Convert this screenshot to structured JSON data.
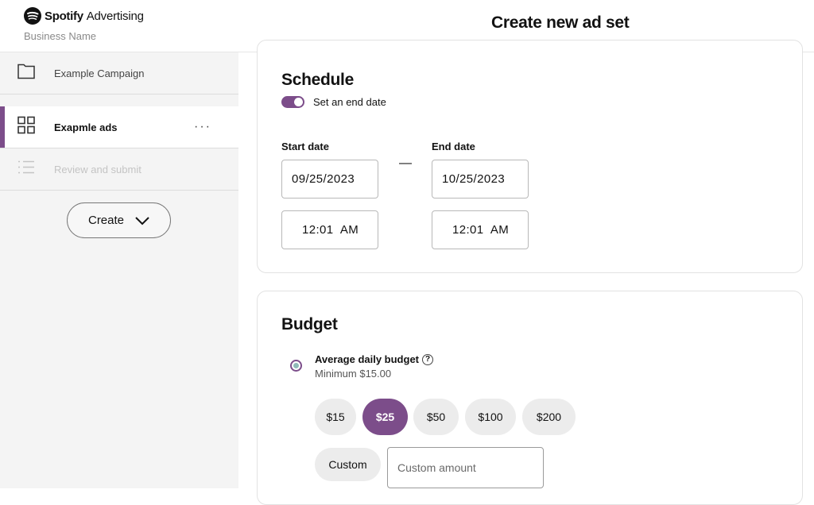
{
  "header": {
    "brand": "Spotify",
    "brand_suffix": "Advertising",
    "business_name": "Business Name",
    "page_title": "Create new ad set"
  },
  "sidebar": {
    "items": [
      {
        "label": "Example Campaign",
        "icon": "folder-icon",
        "state": "normal"
      },
      {
        "label": "Exapmle ads",
        "icon": "grid-icon",
        "state": "active"
      },
      {
        "label": "Review and submit",
        "icon": "list-icon",
        "state": "disabled"
      }
    ],
    "more_label": "···",
    "create_label": "Create"
  },
  "schedule": {
    "title": "Schedule",
    "toggle_label": "Set an end date",
    "toggle_on": true,
    "start_label": "Start date",
    "end_label": "End date",
    "start_date": "09/25/2023",
    "end_date": "10/25/2023",
    "start_time": "12:01  AM",
    "end_time": "12:01  AM",
    "separator": "—"
  },
  "budget": {
    "title": "Budget",
    "option_label": "Average daily budget",
    "option_help": "?",
    "option_sub": "Minimum $15.00",
    "chips": [
      "$15",
      "$25",
      "$50",
      "$100",
      "$200"
    ],
    "selected_chip": "$25",
    "custom_label": "Custom",
    "custom_placeholder": "Custom amount"
  },
  "colors": {
    "accent": "#7c4d8a",
    "sidebar_bg": "#f4f4f4",
    "chip_bg": "#ececec"
  }
}
